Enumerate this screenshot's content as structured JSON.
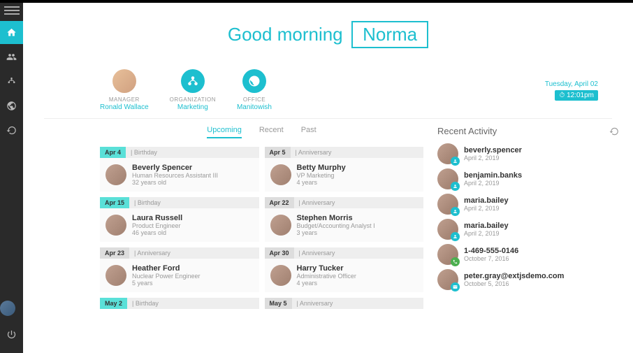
{
  "greeting": {
    "text": "Good morning",
    "name": "Norma"
  },
  "info": {
    "manager": {
      "label": "MANAGER",
      "value": "Ronald Wallace"
    },
    "organization": {
      "label": "ORGANIZATION",
      "value": "Marketing"
    },
    "office": {
      "label": "OFFICE",
      "value": "Manitowish"
    }
  },
  "datetime": {
    "date": "Tuesday, April 02",
    "time": "12:01pm"
  },
  "tabs": {
    "upcoming": "Upcoming",
    "recent": "Recent",
    "past": "Past"
  },
  "events": [
    {
      "date": "Apr 4",
      "type": "Birthday",
      "name": "Beverly Spencer",
      "title": "Human Resources Assistant III",
      "detail": "32 years old",
      "kind": "birthday"
    },
    {
      "date": "Apr 5",
      "type": "Anniversary",
      "name": "Betty Murphy",
      "title": "VP Marketing",
      "detail": "4 years",
      "kind": "anniversary"
    },
    {
      "date": "Apr 15",
      "type": "Birthday",
      "name": "Laura Russell",
      "title": "Product Engineer",
      "detail": "46 years old",
      "kind": "birthday"
    },
    {
      "date": "Apr 22",
      "type": "Anniversary",
      "name": "Stephen Morris",
      "title": "Budget/Accounting Analyst I",
      "detail": "3 years",
      "kind": "anniversary"
    },
    {
      "date": "Apr 23",
      "type": "Anniversary",
      "name": "Heather Ford",
      "title": "Nuclear Power Engineer",
      "detail": "5 years",
      "kind": "anniversary"
    },
    {
      "date": "Apr 30",
      "type": "Anniversary",
      "name": "Harry Tucker",
      "title": "Administrative Officer",
      "detail": "4 years",
      "kind": "anniversary"
    },
    {
      "date": "May 2",
      "type": "Birthday",
      "kind": "birthday",
      "headerOnly": true
    },
    {
      "date": "May 5",
      "type": "Anniversary",
      "kind": "anniversary",
      "headerOnly": true
    }
  ],
  "activity": {
    "title": "Recent Activity",
    "items": [
      {
        "name": "beverly.spencer",
        "date": "April 2, 2019",
        "badge": "user"
      },
      {
        "name": "benjamin.banks",
        "date": "April 2, 2019",
        "badge": "user"
      },
      {
        "name": "maria.bailey",
        "date": "April 2, 2019",
        "badge": "user"
      },
      {
        "name": "maria.bailey",
        "date": "April 2, 2019",
        "badge": "user"
      },
      {
        "name": "1-469-555-0146",
        "date": "October 7, 2016",
        "badge": "phone"
      },
      {
        "name": "peter.gray@extjsdemo.com",
        "date": "October 5, 2016",
        "badge": "mail"
      }
    ]
  }
}
